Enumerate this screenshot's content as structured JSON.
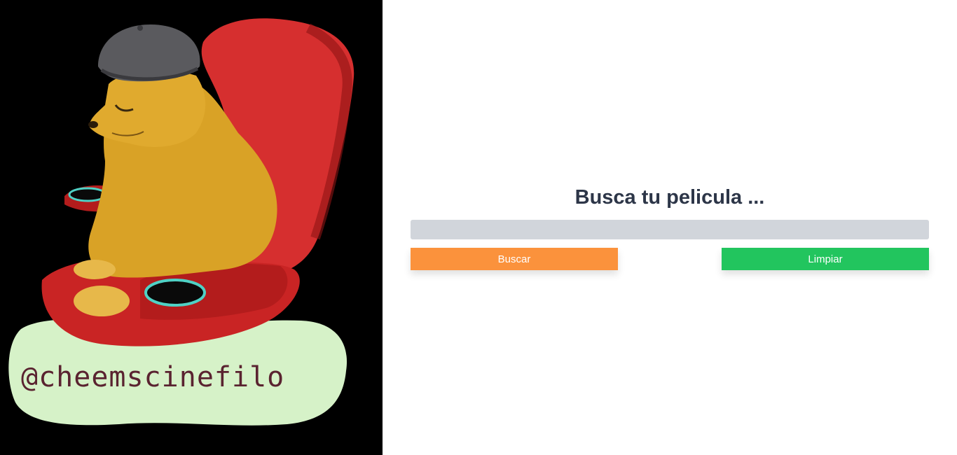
{
  "logo": {
    "handle": "@cheemscinefilo"
  },
  "search": {
    "title": "Busca tu pelicula ...",
    "input_value": "",
    "placeholder": "",
    "search_button_label": "Buscar",
    "clear_button_label": "Limpiar"
  },
  "colors": {
    "search_button": "#fb923c",
    "clear_button": "#22c55e",
    "input_background": "#d1d5db",
    "title": "#2d3648",
    "left_background": "#000000"
  }
}
